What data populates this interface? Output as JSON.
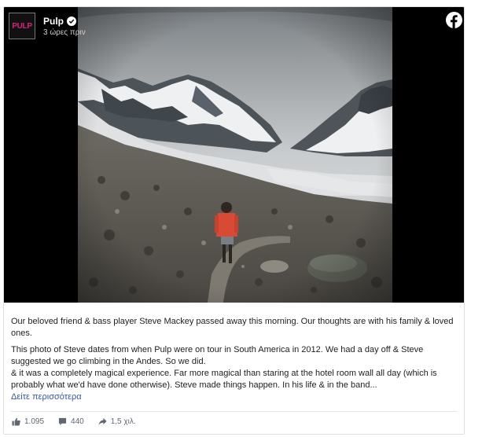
{
  "post": {
    "page_name": "Pulp",
    "logo_text": "PULP",
    "timestamp": "3 ώρες πριν",
    "paragraph_1": "Our beloved friend & bass player Steve Mackey passed away this morning. Our thoughts are with his family & loved ones.",
    "paragraph_2": "This photo of Steve dates from when Pulp were on tour in South America in 2012. We had a day off & Steve suggested we go climbing in the Andes. So we did.",
    "paragraph_3": "& it was a completely magical experience. Far more magical than staring at the hotel room wall all day (which is probably what we'd have done otherwise). Steve made things happen. In his life & in the band...",
    "see_more": "Δείτε περισσότερα"
  },
  "stats": {
    "likes": "1.095",
    "comments": "440",
    "shares": "1,5 χιλ."
  },
  "colors": {
    "link": "#385898",
    "logo_pink": "#d6247a",
    "facebook_icon": "#ffffff"
  },
  "icons": {
    "verified": "verified-badge-icon",
    "facebook": "facebook-logo-icon",
    "like": "thumbs-up-icon",
    "comment": "comment-icon",
    "share": "share-arrow-icon"
  }
}
